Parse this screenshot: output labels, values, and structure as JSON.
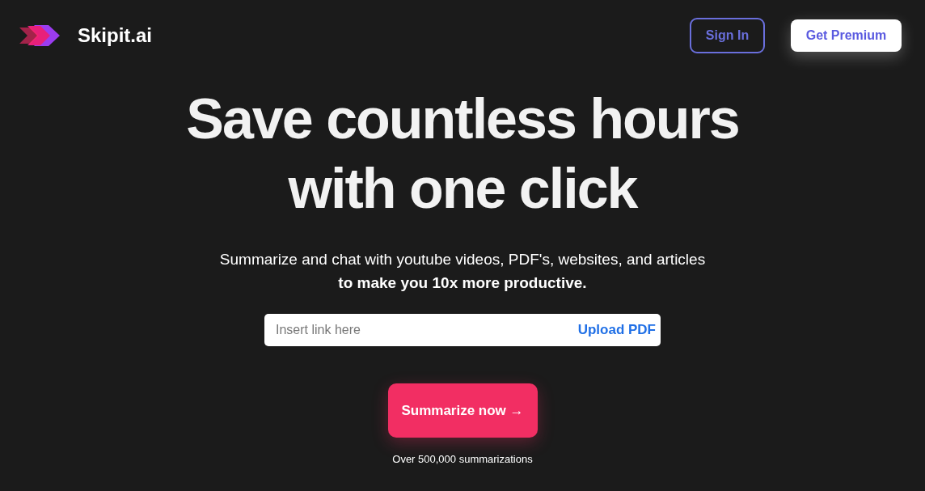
{
  "header": {
    "brand": "Skipit.ai",
    "sign_in": "Sign In",
    "get_premium": "Get Premium"
  },
  "hero": {
    "headline": "Save countless hours with one click",
    "subtitle": "Summarize and chat with youtube videos, PDF's, websites, and articles **to make you 10x more productive.**"
  },
  "link_field": {
    "placeholder": "Insert link here",
    "upload": "Upload PDF"
  },
  "cta": {
    "label": "Summarize now →",
    "note": "Over 500,000 summarizations"
  }
}
